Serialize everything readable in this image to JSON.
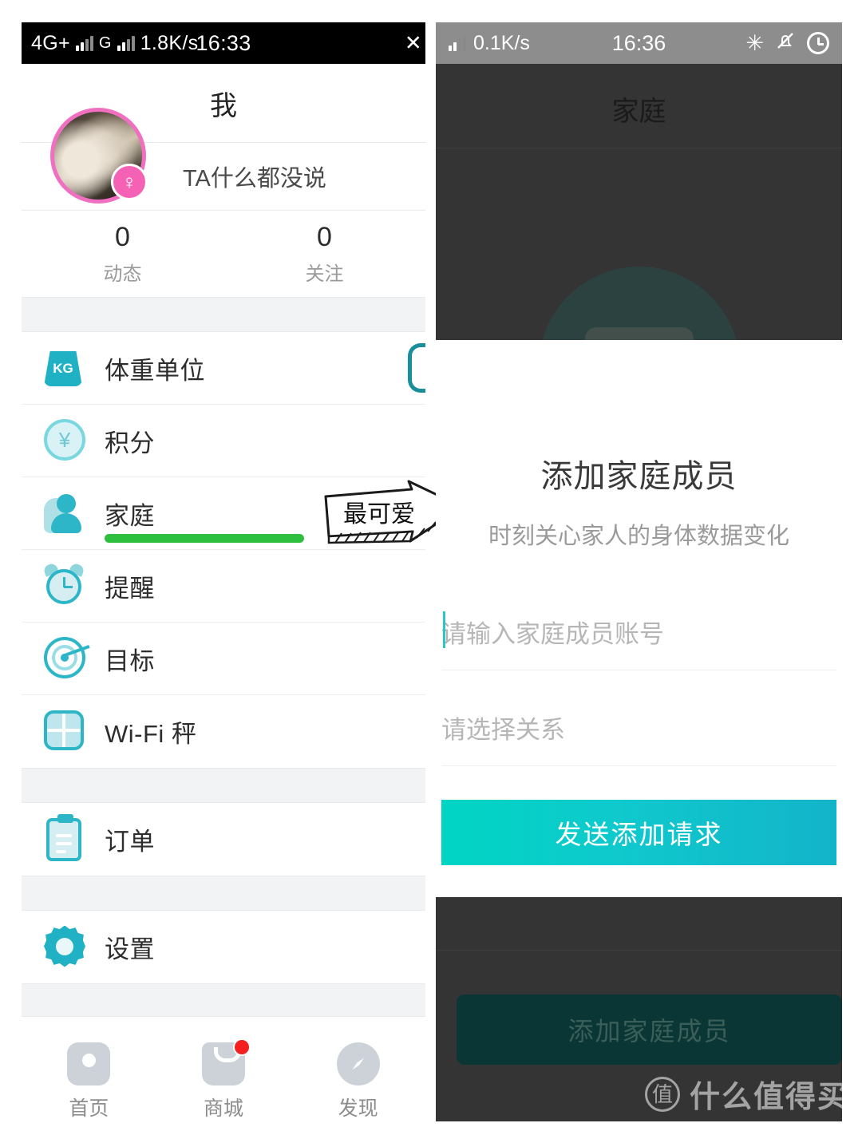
{
  "left_phone": {
    "status_bar": {
      "network_type": "4G+",
      "second_network": "G",
      "data_rate": "1.8K/s",
      "time": "16:33",
      "right_glyph": "✕"
    },
    "header": {
      "title": "我"
    },
    "profile": {
      "signature": "TA什么都没说",
      "gender_symbol": "♀",
      "avatar_ring_color": "#f06fc0"
    },
    "stats": [
      {
        "value": "0",
        "label": "动态"
      },
      {
        "value": "0",
        "label": "关注"
      }
    ],
    "menu_groups": [
      {
        "items": [
          {
            "icon": "weight-kg-icon",
            "icon_text": "KG",
            "label": "体重单位",
            "has_toggle": true
          },
          {
            "icon": "points-coin-icon",
            "icon_text": "¥",
            "label": "积分",
            "has_toggle": false
          },
          {
            "icon": "family-person-icon",
            "icon_text": "",
            "label": "家庭",
            "has_toggle": false,
            "highlighted": true
          },
          {
            "icon": "alarm-clock-icon",
            "icon_text": "",
            "label": "提醒",
            "has_toggle": false
          },
          {
            "icon": "target-icon",
            "icon_text": "",
            "label": "目标",
            "has_toggle": false
          },
          {
            "icon": "wifi-scale-icon",
            "icon_text": "",
            "label": "Wi-Fi 秤",
            "has_toggle": false
          }
        ]
      },
      {
        "items": [
          {
            "icon": "order-clipboard-icon",
            "icon_text": "",
            "label": "订单",
            "has_toggle": false
          }
        ]
      },
      {
        "items": [
          {
            "icon": "settings-gear-icon",
            "icon_text": "",
            "label": "设置",
            "has_toggle": false
          }
        ]
      }
    ],
    "tabbar": [
      {
        "icon": "home-icon",
        "label": "首页",
        "badge": false
      },
      {
        "icon": "shop-bag-icon",
        "label": "商城",
        "badge": true
      },
      {
        "icon": "discover-compass-icon",
        "label": "发现",
        "badge": false
      }
    ]
  },
  "annotation": {
    "sticker_text": "最可爱",
    "underline_color": "#2fbf3f"
  },
  "right_phone": {
    "status_bar": {
      "data_rate": "0.1K/s",
      "time": "16:36",
      "icons": [
        "bluetooth-icon",
        "mute-bell-icon",
        "alarm-clock-icon"
      ],
      "bluetooth_glyph": "✳",
      "mute_glyph": "🔕"
    },
    "dimmed_header": {
      "title": "家庭"
    },
    "content": {
      "title": "添加家庭成员",
      "subtitle": "时刻关心家人的身体数据变化",
      "account_field_placeholder": "请输入家庭成员账号",
      "account_field_value": "",
      "relation_field_placeholder": "请选择关系",
      "relation_field_value": "",
      "submit_label": "发送添加请求",
      "submit_gradient_from": "#00d5c3",
      "submit_gradient_to": "#13b4c9"
    },
    "dimmed_footer": {
      "add_member_button_label": "添加家庭成员"
    }
  },
  "watermark": {
    "logo_char": "值",
    "text": "什么值得买"
  }
}
